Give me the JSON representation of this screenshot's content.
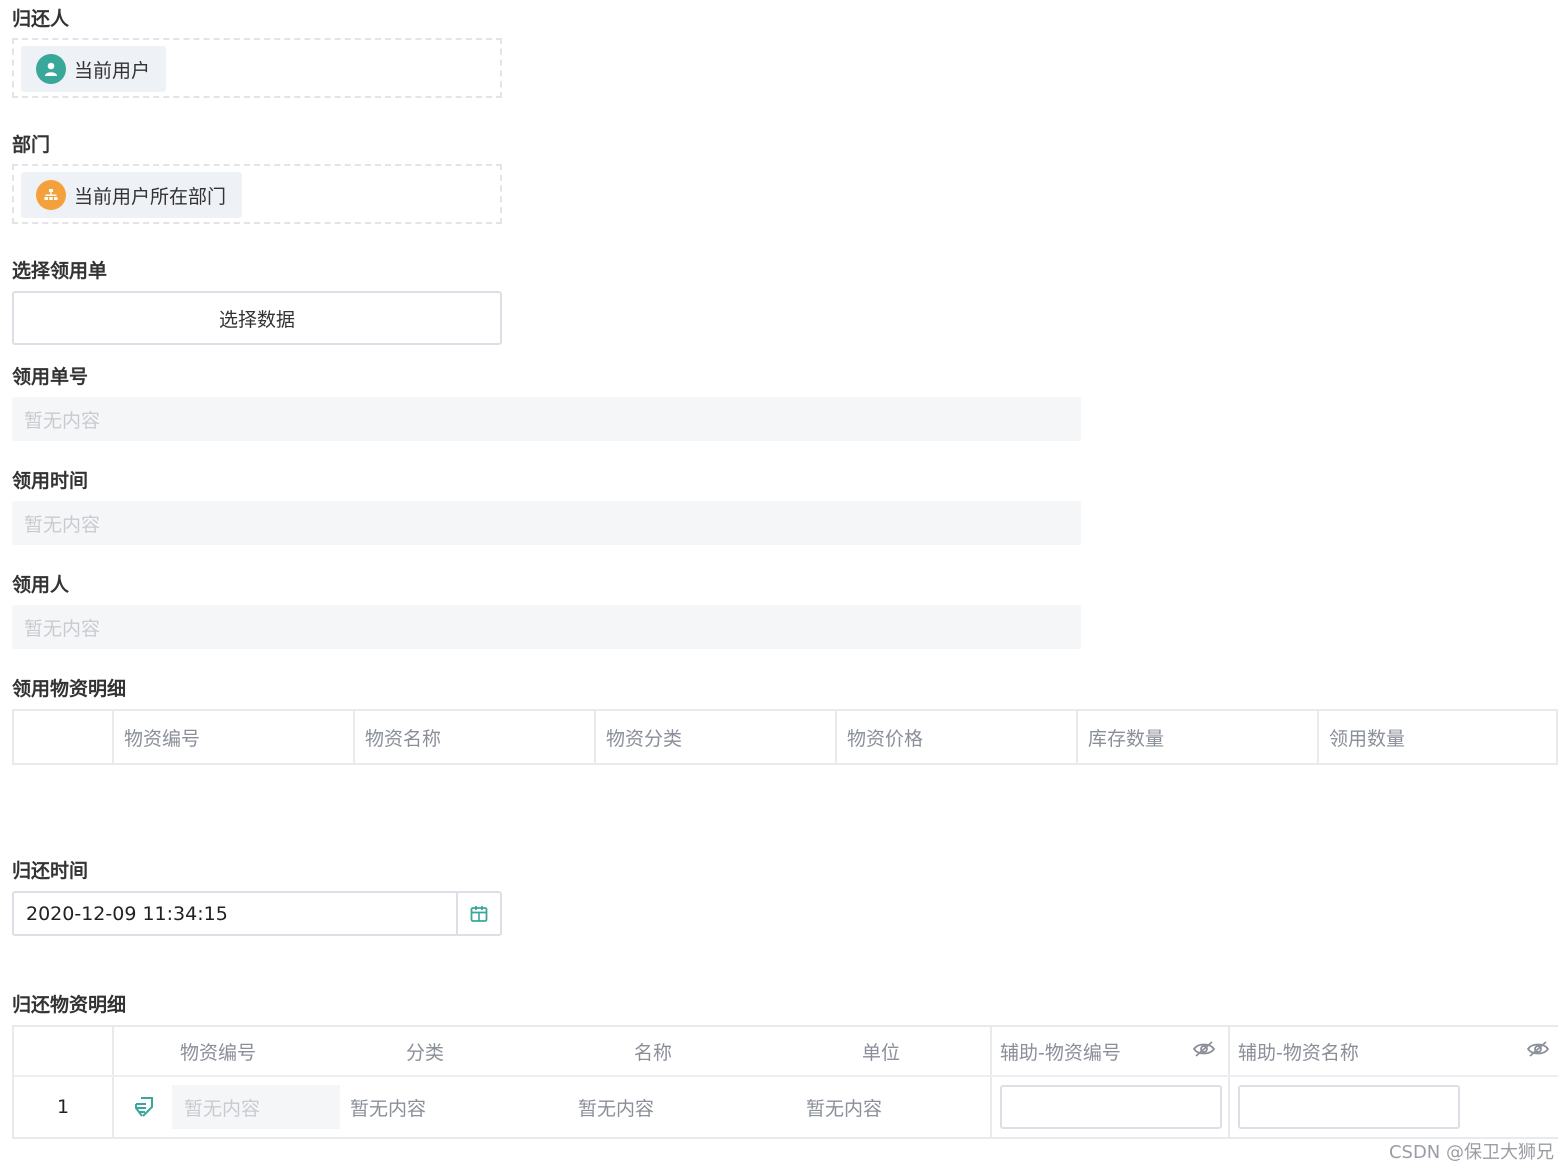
{
  "form": {
    "returner": {
      "label": "归还人",
      "chip": "当前用户"
    },
    "department": {
      "label": "部门",
      "chip": "当前用户所在部门"
    },
    "select_requisition": {
      "label": "选择领用单",
      "button": "选择数据"
    },
    "requisition_no": {
      "label": "领用单号",
      "placeholder": "暂无内容"
    },
    "requisition_time": {
      "label": "领用时间",
      "placeholder": "暂无内容"
    },
    "requisitioner": {
      "label": "领用人",
      "placeholder": "暂无内容"
    },
    "requisition_details": {
      "label": "领用物资明细",
      "columns": [
        "物资编号",
        "物资名称",
        "物资分类",
        "物资价格",
        "库存数量",
        "领用数量"
      ]
    },
    "return_time": {
      "label": "归还时间",
      "value": "2020-12-09 11:34:15"
    },
    "return_details": {
      "label": "归还物资明细",
      "columns": [
        "物资编号",
        "分类",
        "名称",
        "单位",
        "辅助-物资编号",
        "辅助-物资名称"
      ],
      "rows": [
        {
          "index": "1",
          "code": "暂无内容",
          "category": "暂无内容",
          "name": "暂无内容",
          "unit": "暂无内容"
        }
      ]
    }
  },
  "watermark": "CSDN @保卫大狮兄",
  "colors": {
    "teal": "#3aa79b",
    "orange": "#f5a13b",
    "border": "#dcdfe6",
    "readonly_bg": "#f5f6f8"
  }
}
